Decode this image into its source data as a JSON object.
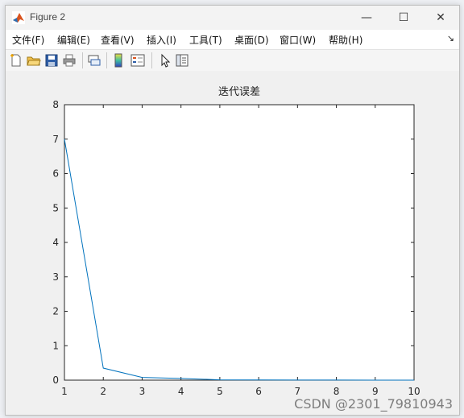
{
  "window": {
    "title": "Figure 2",
    "controls": {
      "minimize": "—",
      "maximize": "☐",
      "close": "✕"
    }
  },
  "menubar": {
    "items": [
      "文件(F)",
      "编辑(E)",
      "查看(V)",
      "插入(I)",
      "工具(T)",
      "桌面(D)",
      "窗口(W)",
      "帮助(H)"
    ],
    "overflow_glyph": "↘"
  },
  "toolbar": {
    "icons": [
      "new-figure-icon",
      "open-folder-icon",
      "save-icon",
      "print-icon",
      "link-plot-icon",
      "colorbar-icon",
      "legend-icon",
      "pointer-icon",
      "property-inspector-icon"
    ]
  },
  "chart_data": {
    "type": "line",
    "title": "迭代误差",
    "xlabel": "",
    "ylabel": "",
    "xlim": [
      1,
      10
    ],
    "ylim": [
      0,
      8
    ],
    "xticks": [
      "1",
      "2",
      "3",
      "4",
      "5",
      "6",
      "7",
      "8",
      "9",
      "10"
    ],
    "yticks": [
      "0",
      "1",
      "2",
      "3",
      "4",
      "5",
      "6",
      "7",
      "8"
    ],
    "grid": false,
    "series": [
      {
        "color": "#0072BD",
        "x": [
          1,
          2,
          3,
          4,
          5,
          6,
          7,
          8,
          9,
          10
        ],
        "y": [
          7.0,
          0.35,
          0.08,
          0.05,
          0.01,
          0.005,
          0.003,
          0.002,
          0.001,
          0.001
        ]
      }
    ]
  },
  "watermark": "CSDN @2301_79810943"
}
